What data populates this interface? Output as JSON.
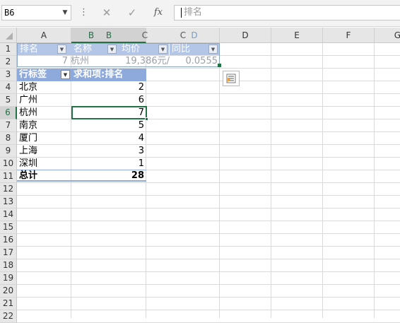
{
  "formula_bar": {
    "name_box": "B6",
    "separator": "⋮",
    "cancel_icon": "✕",
    "enter_icon": "✓",
    "fx_label": "fx",
    "formula_text": "排名"
  },
  "columns": [
    "A",
    "B",
    "C",
    "D",
    "E",
    "F",
    "G"
  ],
  "drag_overlay_labels": [
    "B",
    "B",
    "C",
    "C",
    "D"
  ],
  "rows": [
    "1",
    "2",
    "3",
    "4",
    "5",
    "6",
    "7",
    "8",
    "9",
    "10",
    "11",
    "12",
    "13",
    "14",
    "15",
    "16",
    "17",
    "18",
    "19",
    "20",
    "21",
    "22"
  ],
  "selected_row": "6",
  "ghost_table": {
    "headers": [
      "排名",
      "名称",
      "均价",
      "同比"
    ],
    "row": [
      "7",
      "杭州",
      "19,386元/",
      "0.0555"
    ]
  },
  "pivot": {
    "header_label": "行标签",
    "header_value": "求和项:排名",
    "rows": [
      {
        "label": "北京",
        "value": "2"
      },
      {
        "label": "广州",
        "value": "6"
      },
      {
        "label": "杭州",
        "value": "7"
      },
      {
        "label": "南京",
        "value": "5"
      },
      {
        "label": "厦门",
        "value": "4"
      },
      {
        "label": "上海",
        "value": "3"
      },
      {
        "label": "深圳",
        "value": "1"
      }
    ],
    "total_label": "总计",
    "total_value": "28"
  },
  "colors": {
    "accent": "#217346",
    "pivot_header": "#8ea9db",
    "ghost_header": "#b4c6e7"
  },
  "icons": {
    "quick_analysis": "quick-analysis-icon",
    "dropdown": "chevron-down-icon"
  }
}
